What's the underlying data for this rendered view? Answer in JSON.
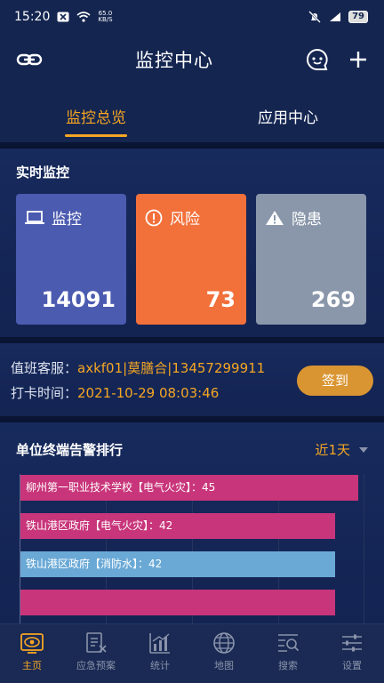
{
  "status_bar": {
    "time": "15:20",
    "net_speed": "65.0",
    "net_unit": "KB/S",
    "battery": "79"
  },
  "header": {
    "title": "监控中心"
  },
  "tabs": [
    {
      "label": "监控总览",
      "active": true
    },
    {
      "label": "应用中心",
      "active": false
    }
  ],
  "realtime": {
    "title": "实时监控",
    "cards": [
      {
        "label": "监控",
        "value": "14091",
        "icon": "laptop-icon",
        "color": "#4b5bb0"
      },
      {
        "label": "风险",
        "value": "73",
        "icon": "alert-circle-icon",
        "color": "#f2703a"
      },
      {
        "label": "隐患",
        "value": "269",
        "icon": "warning-triangle-icon",
        "color": "#8a97aa"
      }
    ]
  },
  "duty": {
    "service_label": "值班客服：",
    "service_value": "axkf01|莫膳合|13457299911",
    "checkin_label": "打卡时间：",
    "checkin_value": "2021-10-29 08:03:46",
    "checkin_button": "签到"
  },
  "ranking": {
    "title": "单位终端告警排行",
    "filter": "近1天"
  },
  "chart_data": {
    "type": "bar",
    "orientation": "horizontal",
    "categories": [
      "柳州第一职业技术学校【电气火灾】",
      "铁山港区政府【电气火灾】",
      "铁山港区政府【消防水】",
      ""
    ],
    "labels": [
      "柳州第一职业技术学校【电气火灾】：45",
      "铁山港区政府【电气火灾】：42",
      "铁山港区政府【消防水】：42",
      ""
    ],
    "values": [
      45,
      42,
      42,
      42
    ],
    "colors": [
      "#c8357a",
      "#c8357a",
      "#6aa9d6",
      "#c8357a"
    ],
    "xlim": [
      0,
      46
    ]
  },
  "bottom_nav": [
    {
      "label": "主页",
      "icon": "monitor-eye-icon",
      "active": true
    },
    {
      "label": "应急预案",
      "icon": "plan-document-icon",
      "active": false
    },
    {
      "label": "统计",
      "icon": "statistics-chart-icon",
      "active": false
    },
    {
      "label": "地图",
      "icon": "globe-map-icon",
      "active": false
    },
    {
      "label": "搜索",
      "icon": "search-list-icon",
      "active": false
    },
    {
      "label": "设置",
      "icon": "settings-sliders-icon",
      "active": false
    }
  ]
}
